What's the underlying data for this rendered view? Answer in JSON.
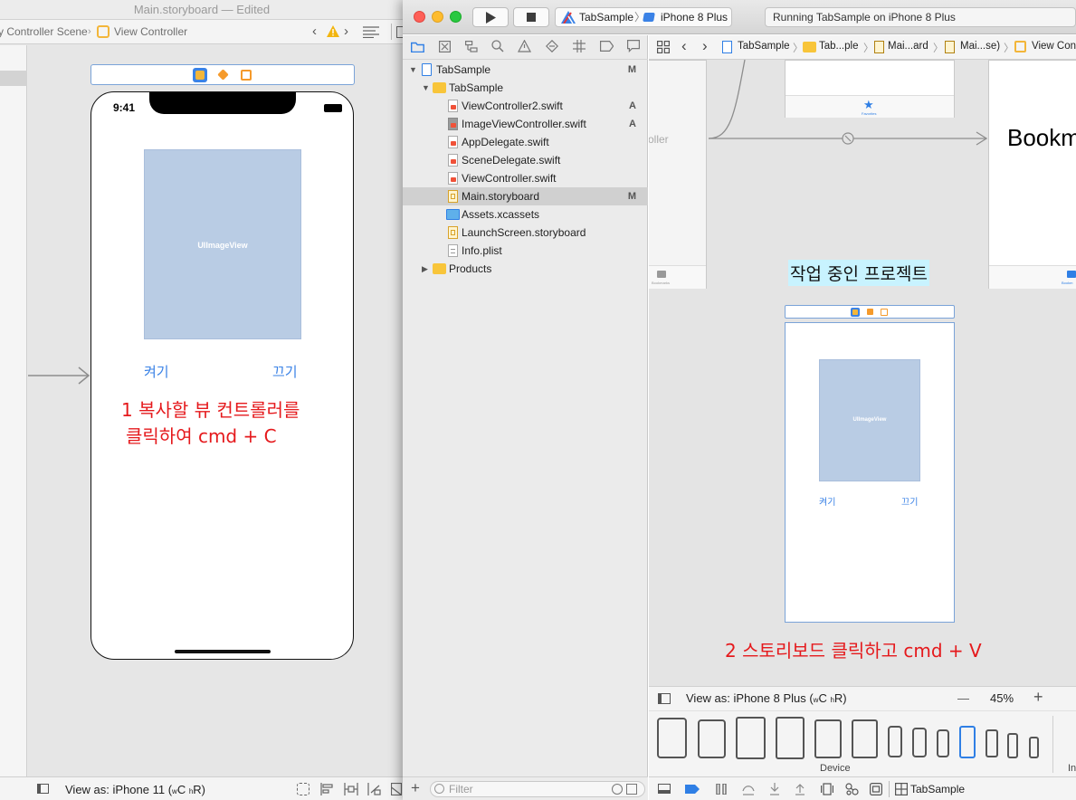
{
  "background_window": {
    "title": "Main.storyboard — Edited",
    "breadcrumb": {
      "scene": "y Controller Scene",
      "controller": "View Controller"
    },
    "view_as": "View as: iPhone 11 (",
    "view_as_w": "w",
    "view_as_c": "C ",
    "view_as_h": "h",
    "view_as_r": "R)"
  },
  "phone": {
    "time": "9:41",
    "image_view_label": "UIImageView",
    "button_on": "켜기",
    "button_off": "끄기",
    "note_line1": "1 복사할 뷰 컨트롤러를",
    "note_line2": "클릭하여 cmd + C"
  },
  "toolbar": {
    "scheme_project": "TabSample",
    "scheme_device": "iPhone 8 Plus",
    "status": "Running TabSample on iPhone 8 Plus"
  },
  "navigator": {
    "filter_placeholder": "Filter",
    "items": [
      {
        "label": "TabSample",
        "status": "M"
      },
      {
        "label": "TabSample",
        "status": ""
      },
      {
        "label": "ViewController2.swift",
        "status": "A"
      },
      {
        "label": "ImageViewController.swift",
        "status": "A"
      },
      {
        "label": "AppDelegate.swift",
        "status": ""
      },
      {
        "label": "SceneDelegate.swift",
        "status": ""
      },
      {
        "label": "ViewController.swift",
        "status": ""
      },
      {
        "label": "Main.storyboard",
        "status": "M"
      },
      {
        "label": "Assets.xcassets",
        "status": ""
      },
      {
        "label": "LaunchScreen.storyboard",
        "status": ""
      },
      {
        "label": "Info.plist",
        "status": ""
      },
      {
        "label": "Products",
        "status": ""
      }
    ]
  },
  "jump_bar": [
    "TabSample",
    "Tab...ple",
    "Mai...ard",
    "Mai...se)",
    "View Con"
  ],
  "canvas": {
    "left_scene_text": "oller",
    "left_tab_label": "Bookmarks",
    "top_tab_label": "Favorites",
    "bookmarks_title": "Bookm",
    "right_tab_label": "Bookm",
    "scene_label": "작업 중인 프로젝트",
    "image_view_label": "UIImageView",
    "button_on": "켜기",
    "button_off": "끄기",
    "note": "2 스토리보드 클릭하고 cmd + V"
  },
  "view_as_bar": {
    "text": "View as: iPhone 8 Plus (",
    "w": "w",
    "c": "C ",
    "h": "h",
    "r": "R)",
    "zoom": "45%",
    "minus": "—",
    "plus": "+"
  },
  "device_bar": {
    "label": "Device",
    "cut_label": "In"
  },
  "editor_bottom": {
    "scheme": "TabSample"
  },
  "colors": {
    "accent": "#3a82e6",
    "annotation": "#e5191c",
    "image_view": "#b9cce4",
    "scene_label_bg": "#c8f3ff"
  }
}
